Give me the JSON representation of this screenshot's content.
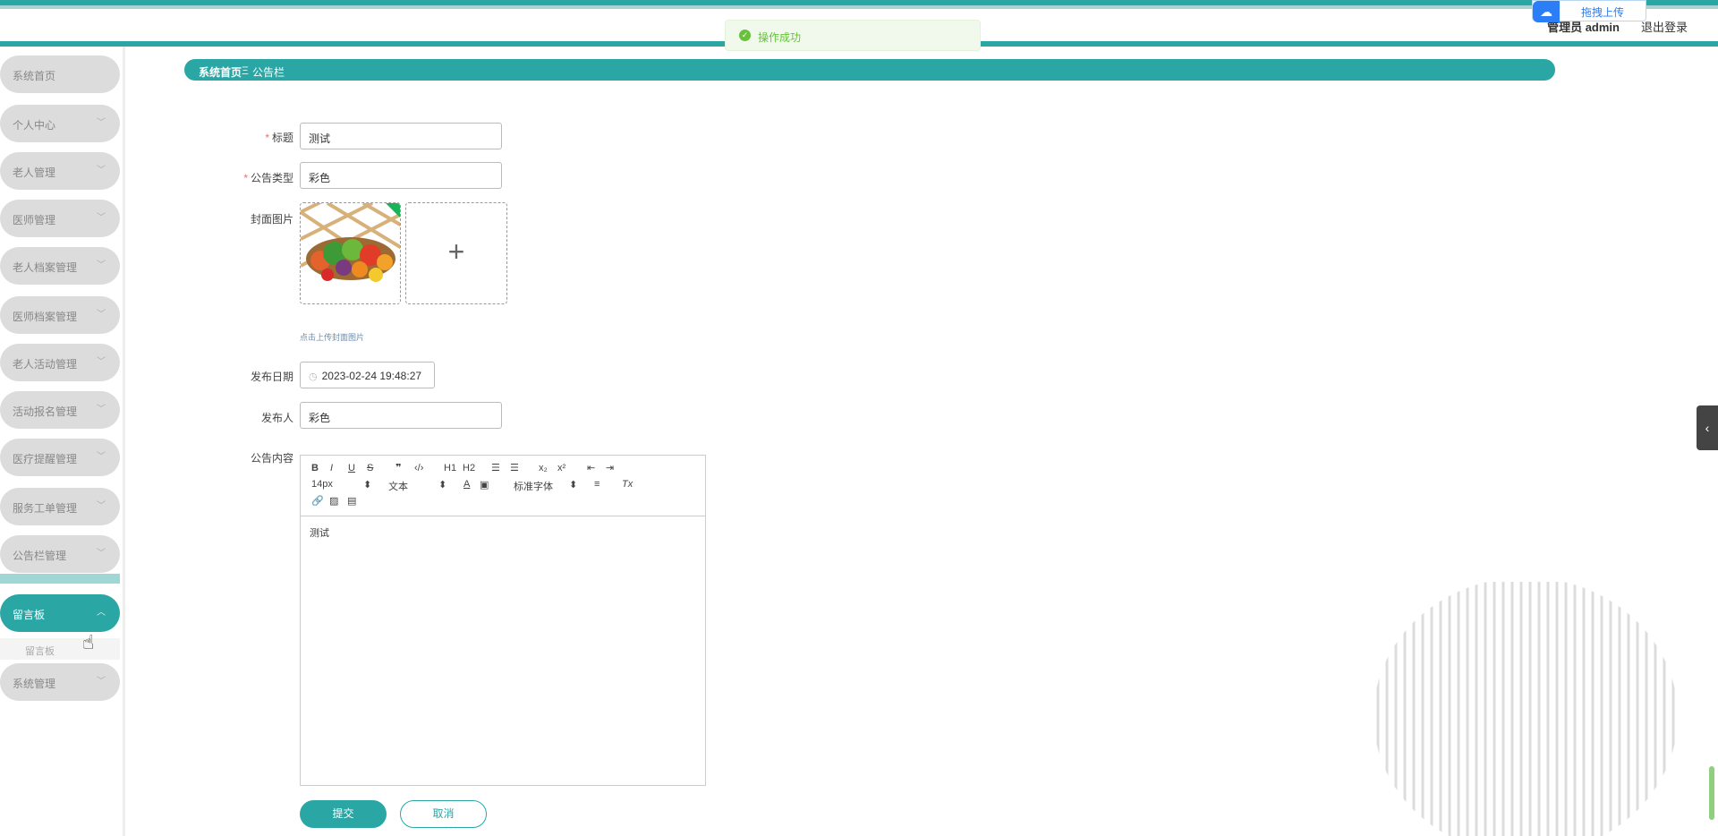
{
  "header": {
    "user_label": "管理员 admin",
    "logout_label": "退出登录",
    "upload_float_label": "拖拽上传"
  },
  "toast": {
    "message": "操作成功"
  },
  "sidebar": {
    "items": [
      {
        "label": "系统首页"
      },
      {
        "label": "个人中心"
      },
      {
        "label": "老人管理"
      },
      {
        "label": "医师管理"
      },
      {
        "label": "老人档案管理"
      },
      {
        "label": "医师档案管理"
      },
      {
        "label": "老人活动管理"
      },
      {
        "label": "活动报名管理"
      },
      {
        "label": "医疗提醒管理"
      },
      {
        "label": "服务工单管理"
      },
      {
        "label": "公告栏管理"
      },
      {
        "label": "留言板"
      },
      {
        "label": "系统管理"
      }
    ],
    "active_submenu": "留言板"
  },
  "breadcrumb": {
    "home": "系统首页",
    "separator": "Ξ",
    "current": "公告栏"
  },
  "form": {
    "title_label": "标题",
    "title_value": "测试",
    "type_label": "公告类型",
    "type_value": "彩色",
    "cover_label": "封面图片",
    "cover_hint": "点击上传封面图片",
    "date_label": "发布日期",
    "date_value": "2023-02-24 19:48:27",
    "publisher_label": "发布人",
    "publisher_value": "彩色",
    "content_label": "公告内容",
    "content_value": "测试",
    "submit_label": "提交",
    "cancel_label": "取消"
  },
  "editor_toolbar": {
    "font_size": "14px",
    "header_select": "文本",
    "font_family": "标准字体",
    "h1": "H1",
    "h2": "H2"
  },
  "colors": {
    "accent": "#2aa7a5",
    "success": "#67c23a",
    "required": "#f56c6c"
  }
}
